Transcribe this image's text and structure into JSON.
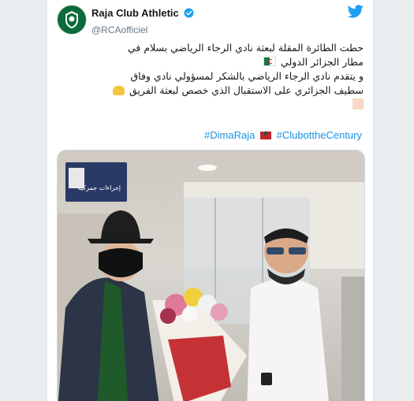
{
  "tweet": {
    "display_name": "Raja Club Athletic",
    "handle": "@RCAofficiel",
    "line1": "حطت الطائرة المقلة لبعثة نادي الرجاء الرياضي بسلام في",
    "line2": "مطار الجزائر الدولي",
    "line3": "و يتقدم نادي الرجاء الرياضي بالشكر لمسؤولي نادي وفاق",
    "line4": "سطيف الجزائري على الاستقبال الذي خصص لبعثة الفريق",
    "hashtag1": "#DimaRaja",
    "hashtag2": "#ClubottheCentury",
    "photo_sign_text": "إجراءات جمركية"
  },
  "icons": {
    "avatar": "raja-club-crest",
    "verified": "verified-badge-icon",
    "platform": "twitter-bird-icon",
    "flag1": "algeria-flag-emoji",
    "flag2": "morocco-flag-emoji",
    "emoji": "handshake-emoji"
  },
  "colors": {
    "link": "#1b95e0",
    "brand": "#1da1f2",
    "club_green": "#0c6b3a"
  }
}
